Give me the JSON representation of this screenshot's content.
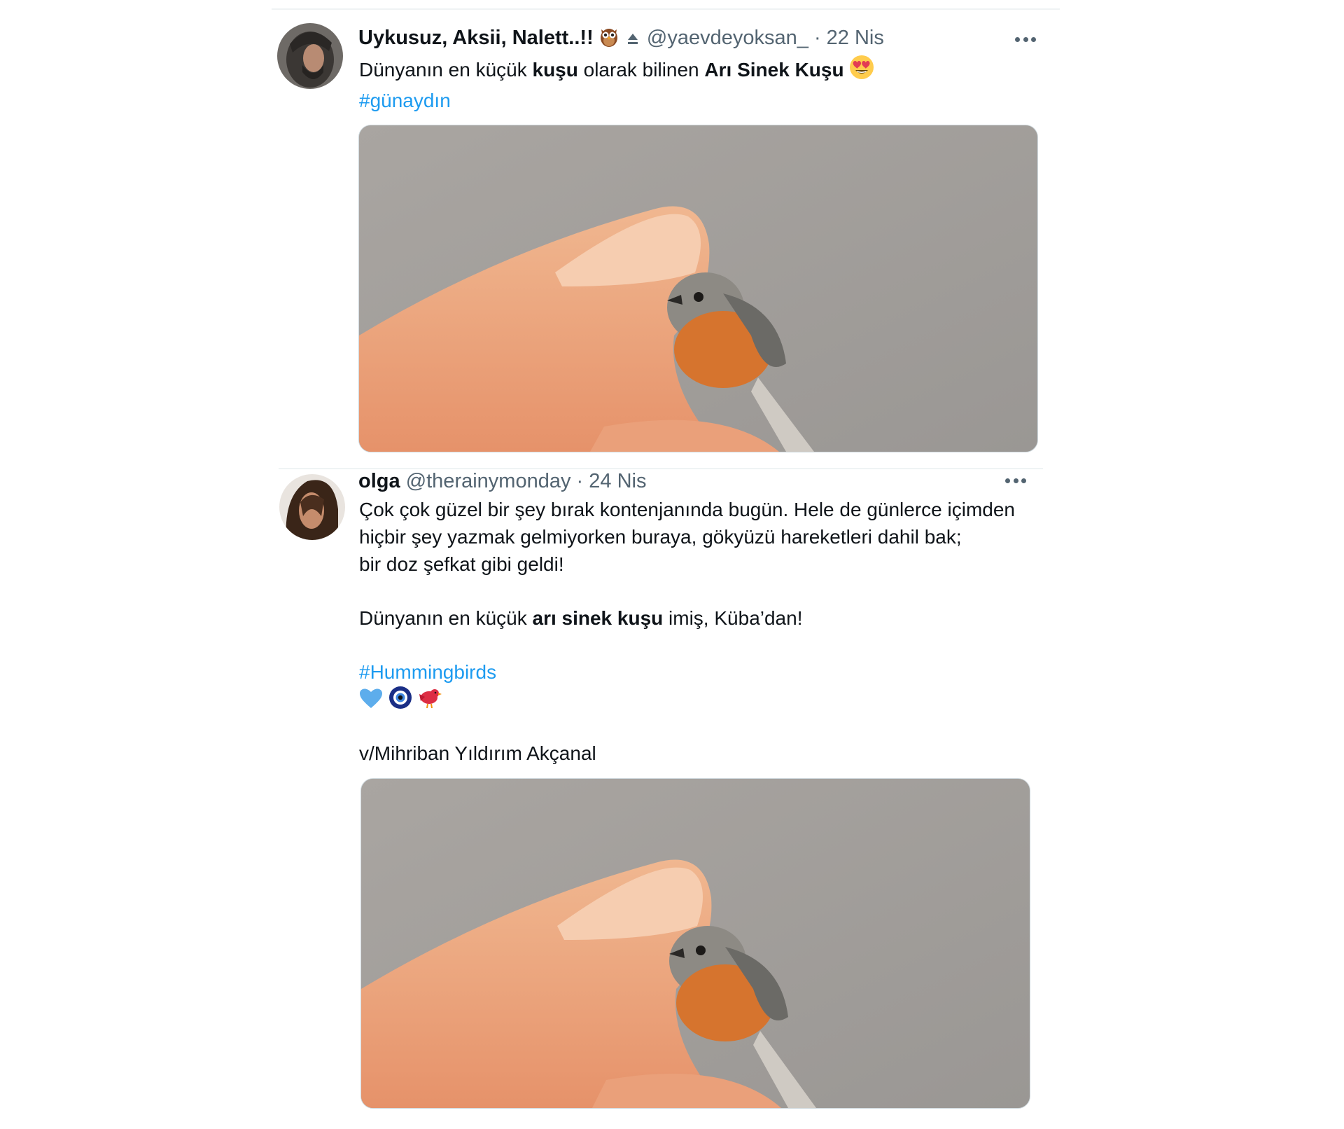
{
  "tweets": [
    {
      "author": {
        "name": "Uykusuz, Aksii, Nalett..!!",
        "handle": "@yaevdeyoksan_",
        "date": "22 Nis"
      },
      "name_emoji": "owl-emoji",
      "badge_icon": "eject-icon",
      "text": {
        "line1_a": "Dünyanın en küçük ",
        "line1_b": "kuşu",
        "line1_c": " olarak bilinen ",
        "line1_d": "Arı Sinek Kuşu",
        "trailing_emoji": "heart-eyes-emoji",
        "hashtag": "#günaydın"
      },
      "media_alt": "tiny-bird-on-finger-photo"
    },
    {
      "author": {
        "name": "olga",
        "handle": "@therainymonday",
        "date": "24 Nis"
      },
      "text": {
        "p1_l1": "Çok çok güzel bir şey bırak kontenjanında bugün. Hele de günlerce içimden",
        "p1_l2": "hiçbir şey yazmak gelmiyorken buraya, gökyüzü hareketleri dahil bak;",
        "p1_l3": "bir doz şefkat gibi geldi!",
        "p2_a": "Dünyanın en küçük ",
        "p2_b": "arı sinek kuşu",
        "p2_c": " imiş, Küba’dan!",
        "hashtag": "#Hummingbirds",
        "emojis": [
          "blue-heart-emoji",
          "nazar-amulet-emoji",
          "red-bird-emoji"
        ],
        "credit": "v/Mihriban Yıldırım Akçanal"
      },
      "media_alt": "tiny-bird-on-finger-photo"
    }
  ],
  "separator": " · ",
  "colors": {
    "hashtag": "#1d9bf0",
    "secondary_text": "#536471",
    "primary_text": "#0f1419"
  }
}
